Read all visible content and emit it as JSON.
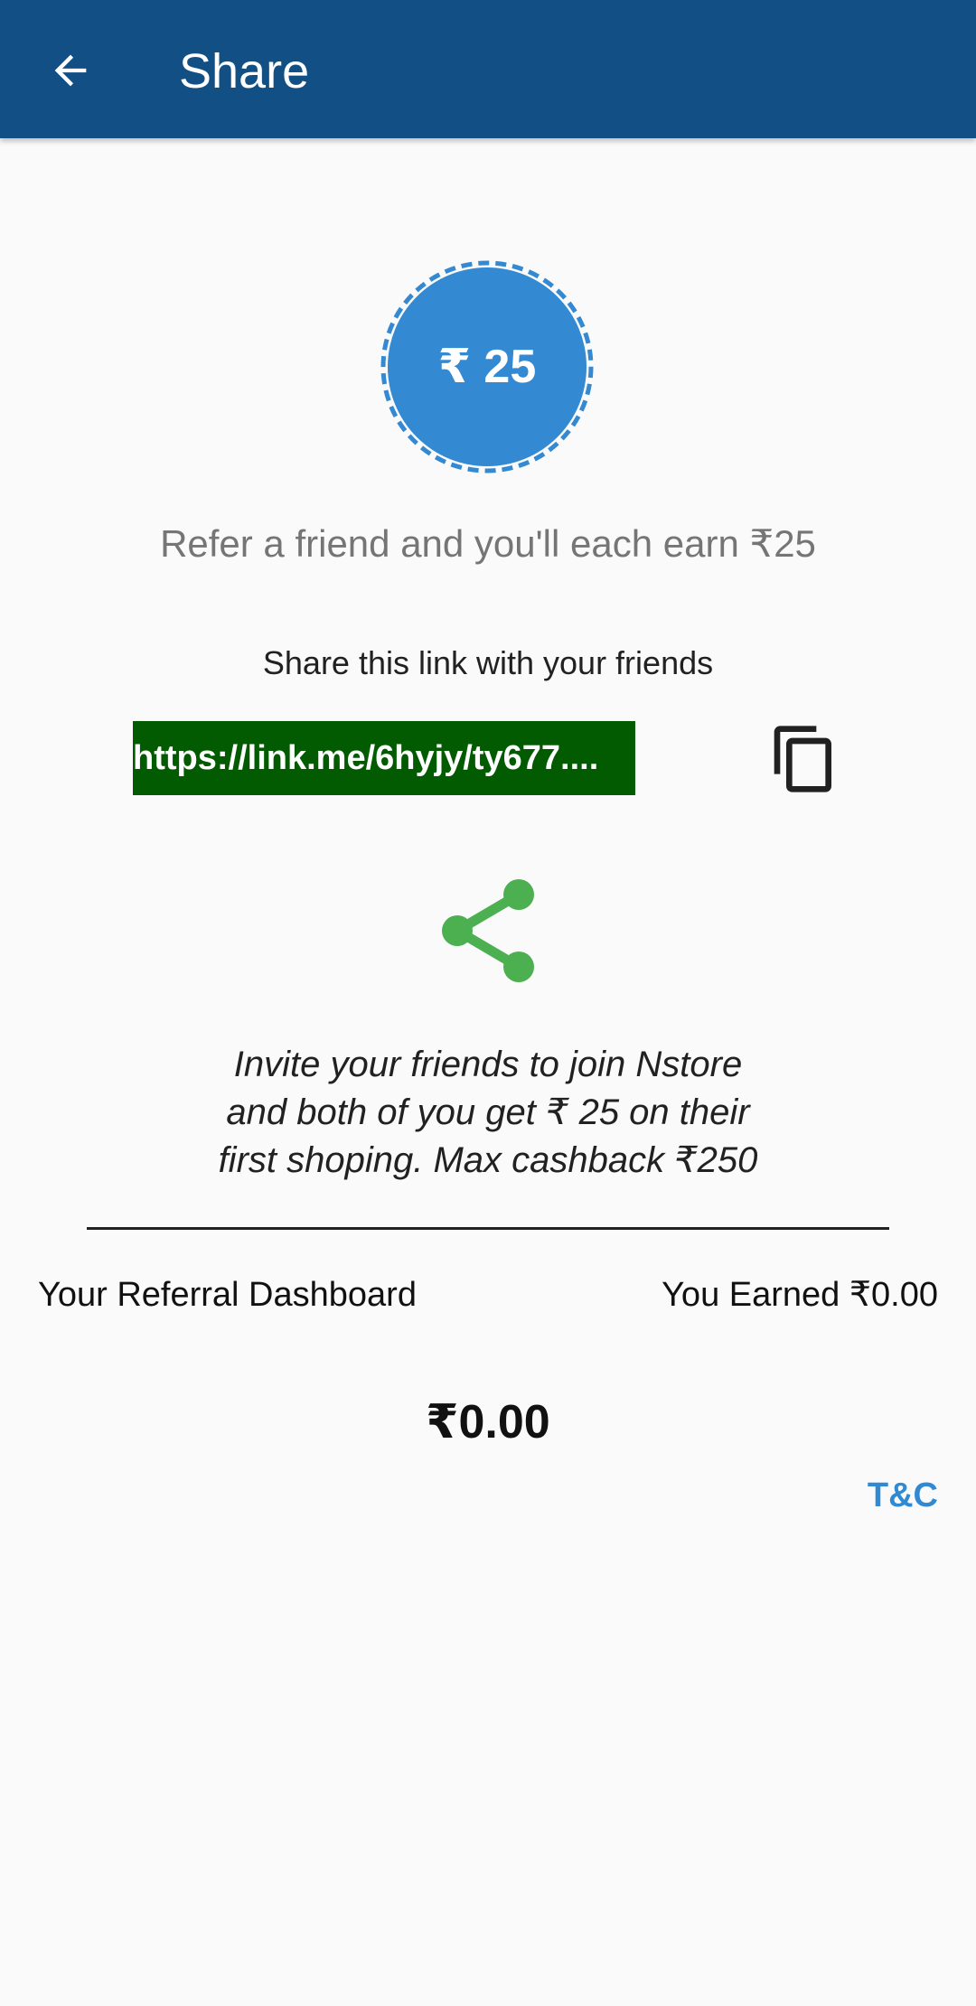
{
  "appbar": {
    "title": "Share",
    "back_icon": "arrow-left-icon",
    "color": "#114f84"
  },
  "badge": {
    "text": "₹ 25",
    "color": "#3389d2"
  },
  "refer_text": "Refer a friend and you'll each earn ₹25",
  "share_label": "Share this link with your friends",
  "link": {
    "text": "https://link.me/6hyjy/ty677....",
    "background": "#025b00"
  },
  "copy_icon": "copy-icon",
  "share_icon": "share-icon",
  "share_icon_color": "#4caf50",
  "invite": {
    "line1": "Invite your friends to join Nstore",
    "line2": "and both of you get ₹ 25 on their",
    "line3": "first shoping. Max cashback ₹250"
  },
  "dashboard": {
    "label": "Your Referral Dashboard",
    "earned": "You Earned ₹0.00",
    "amount": "₹0.00"
  },
  "tnc": {
    "label": "T&C",
    "color": "#2f8ad3"
  }
}
